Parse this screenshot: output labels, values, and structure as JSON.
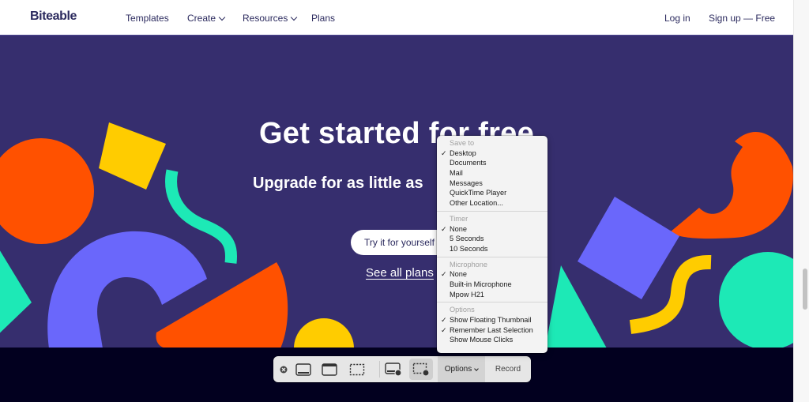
{
  "nav": {
    "logo": "Biteable",
    "links": [
      {
        "label": "Templates",
        "has_dropdown": false
      },
      {
        "label": "Create",
        "has_dropdown": true
      },
      {
        "label": "Resources",
        "has_dropdown": true
      },
      {
        "label": "Plans",
        "has_dropdown": false
      }
    ],
    "login": "Log in",
    "signup": "Sign up — Free"
  },
  "hero": {
    "title": "Get started for free",
    "subtitle": "Upgrade for as little as",
    "cta": "Try it for yourself",
    "plans_link": "See all plans"
  },
  "colors": {
    "hero_bg": "#362e6e",
    "orange": "#ff5100",
    "yellow": "#ffcc00",
    "teal": "#1de9b6",
    "violet": "#6a67fb",
    "footer_bg": "#02001f",
    "text_navy": "#2b2a5e"
  },
  "screenshot_menu": {
    "sections": [
      {
        "header": "Save to",
        "items": [
          {
            "label": "Desktop",
            "checked": true
          },
          {
            "label": "Documents",
            "checked": false
          },
          {
            "label": "Mail",
            "checked": false
          },
          {
            "label": "Messages",
            "checked": false
          },
          {
            "label": "QuickTime Player",
            "checked": false
          },
          {
            "label": "Other Location...",
            "checked": false
          }
        ]
      },
      {
        "header": "Timer",
        "items": [
          {
            "label": "None",
            "checked": true
          },
          {
            "label": "5 Seconds",
            "checked": false
          },
          {
            "label": "10 Seconds",
            "checked": false
          }
        ]
      },
      {
        "header": "Microphone",
        "items": [
          {
            "label": "None",
            "checked": true
          },
          {
            "label": "Built-in Microphone",
            "checked": false
          },
          {
            "label": "Mpow H21",
            "checked": false
          }
        ]
      },
      {
        "header": "Options",
        "items": [
          {
            "label": "Show Floating Thumbnail",
            "checked": true
          },
          {
            "label": "Remember Last Selection",
            "checked": true
          },
          {
            "label": "Show Mouse Clicks",
            "checked": false
          }
        ]
      }
    ],
    "check_glyph": "✓"
  },
  "screenshot_toolbar": {
    "buttons": [
      {
        "icon": "close-icon"
      },
      {
        "icon": "capture-entire-screen-icon"
      },
      {
        "icon": "capture-window-icon"
      },
      {
        "icon": "capture-selection-icon"
      },
      {
        "icon": "record-entire-screen-icon"
      },
      {
        "icon": "record-selection-icon",
        "selected": true
      }
    ],
    "options_label": "Options",
    "record_label": "Record"
  }
}
